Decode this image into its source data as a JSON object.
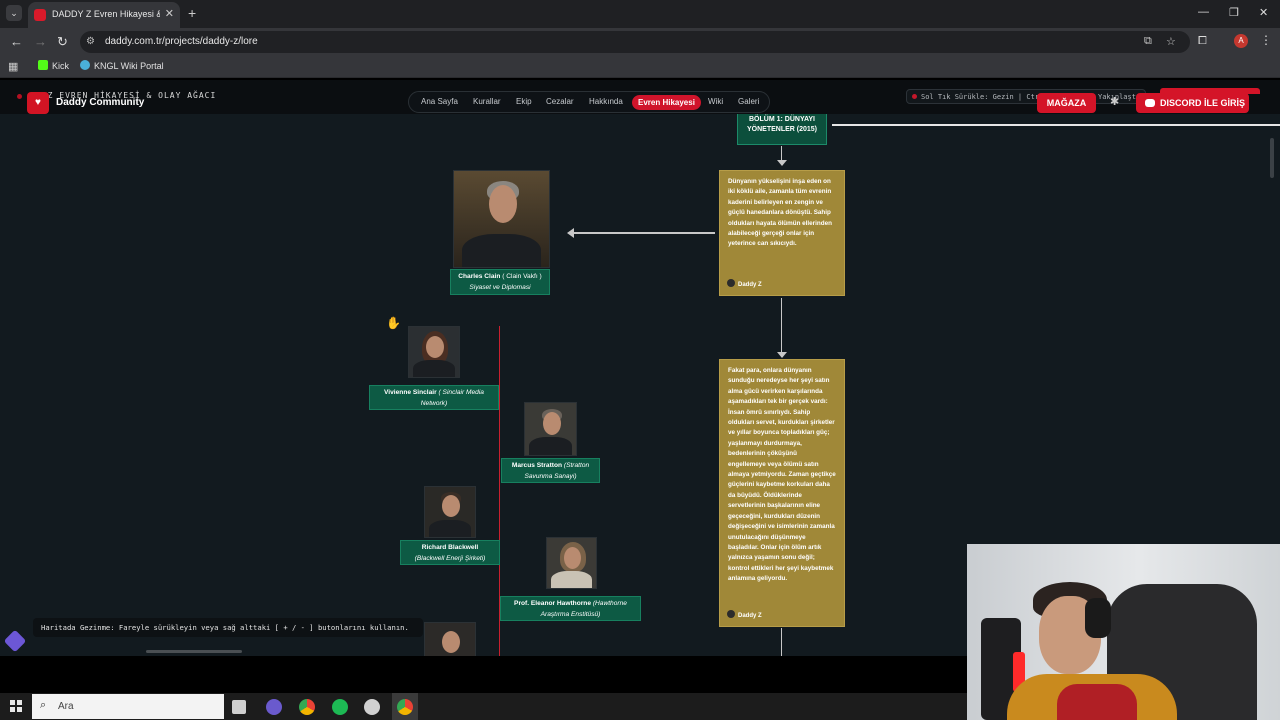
{
  "browser": {
    "tab_title": "DADDY Z Evren Hikayesi & Wiki",
    "url": "daddy.com.tr/projects/daddy-z/lore",
    "profile_initial": "A",
    "bookmarks": [
      {
        "label": "Kick",
        "color": "#53fc18"
      },
      {
        "label": "KNGL Wiki Portal",
        "color": "#4ab0d9"
      }
    ]
  },
  "site": {
    "logo_text": "Daddy Community",
    "ghost_title": "Y Z EVREN HİKAYESİ & OLAY AĞACI",
    "nav": [
      {
        "label": "Ana Sayfa",
        "active": false
      },
      {
        "label": "Kurallar",
        "active": false
      },
      {
        "label": "Ekip",
        "active": false
      },
      {
        "label": "Cezalar",
        "active": false
      },
      {
        "label": "Hakkında",
        "active": false
      },
      {
        "label": "Evren Hikayesi",
        "active": true
      },
      {
        "label": "Wiki",
        "active": false
      },
      {
        "label": "Galeri",
        "active": false
      }
    ],
    "hint": "Sol Tık Sürükle: Gezin | Ctrl + Tekerlek: Yakınlaştır",
    "store_button": "MAĞAZA",
    "discord_button": "DISCORD İLE GİRİŞ",
    "accent_color": "#d41428"
  },
  "tree": {
    "chapter": "BÖLÜM 1: DÜNYAYI YÖNETENLER (2015)",
    "story_cards": [
      {
        "text": "Dünyanın yükselişini inşa eden on iki köklü aile, zamanla tüm evrenin kaderini belirleyen en zengin ve güçlü hanedanlara dönüştü. Sahip oldukları hayata ölümün ellerinden alabileceği gerçeği onlar için yeterince can sıkıcıydı.",
        "author": "Daddy Z"
      },
      {
        "text": "Fakat para, onlara dünyanın sunduğu neredeyse her şeyi satın alma gücü verirken karşılarında aşamadıkları tek bir gerçek vardı: İnsan ömrü sınırlıydı. Sahip oldukları servet, kurdukları şirketler ve yıllar boyunca topladıkları güç; yaşlanmayı durdurmaya, bedenlerinin çöküşünü engellemeye veya ölümü satın almaya yetmiyordu. Zaman geçtikçe güçlerini kaybetme korkuları daha da büyüdü. Öldüklerinde servetlerinin başkalarının eline geçeceğini, kurdukları düzenin değişeceğini ve isimlerinin zamanla unutulacağını düşünmeye başladılar. Onlar için ölüm artık yalnızca yaşamın sonu değil; kontrol ettikleri her şeyi kaybetmek anlamına geliyordu.",
        "author": "Daddy Z"
      }
    ],
    "characters": [
      {
        "name": "Charles Clain",
        "org": "( Clain Vakfı )",
        "role": "Siyaset ve Diplomasi"
      },
      {
        "name": "Vivienne Sinclair",
        "org": "( Sinclair Media Network)"
      },
      {
        "name": "Marcus Stratton",
        "org": "(Stratton Savunma Sanayi)"
      },
      {
        "name": "Richard Blackwell",
        "org": "(Blackwell Enerji Şirketi)"
      },
      {
        "name": "Prof. Eleanor Hawthorne",
        "org": "(Hawthorne Araştırma Enstitüsü)"
      }
    ],
    "map_hint": "Haritada Gezinme: Fareyle sürükleyin veya sağ alttaki [ + / - ] butonlarını kullanın."
  },
  "taskbar": {
    "search_placeholder": "Ara",
    "apps": [
      {
        "name": "task-view-icon",
        "color": "#cfcfcf"
      },
      {
        "name": "app-icon",
        "color": "#6a5acd"
      },
      {
        "name": "chrome-icon",
        "color": "#f2b400"
      },
      {
        "name": "spotify-icon",
        "color": "#1db954"
      },
      {
        "name": "app-icon-2",
        "color": "#d0d0d0"
      },
      {
        "name": "chrome-active-icon",
        "color": "#e94235"
      }
    ]
  }
}
